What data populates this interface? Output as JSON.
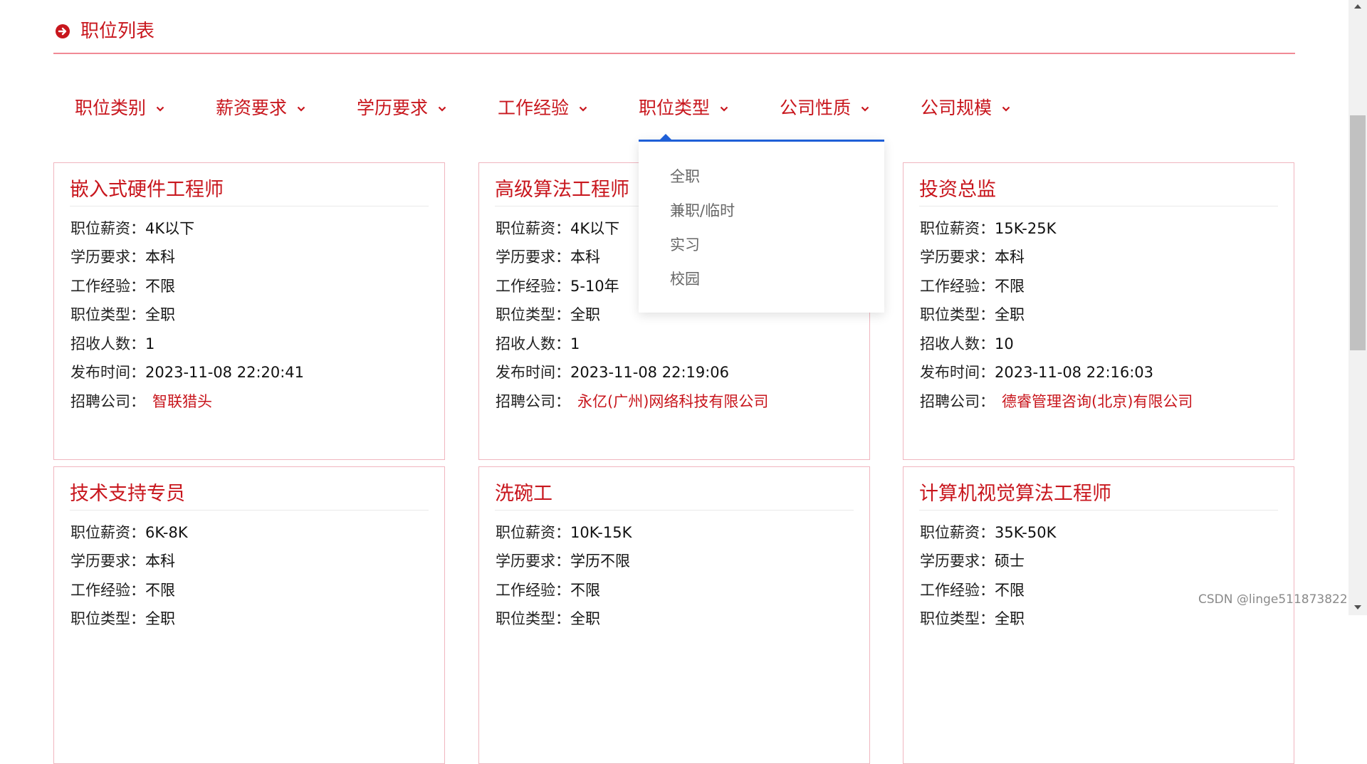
{
  "colors": {
    "accent": "#c8161d",
    "card_border": "#f0b6bf",
    "dropdown_border": "#1e5fd7",
    "scrollbar_thumb": "#c1c1c1"
  },
  "header": {
    "icon": "arrow-right-circle-icon",
    "title": "职位列表"
  },
  "filters": [
    {
      "label": "职位类别",
      "icon": "chevron-down-icon"
    },
    {
      "label": "薪资要求",
      "icon": "chevron-down-icon"
    },
    {
      "label": "学历要求",
      "icon": "chevron-down-icon"
    },
    {
      "label": "工作经验",
      "icon": "chevron-down-icon"
    },
    {
      "label": "职位类型",
      "icon": "chevron-down-icon"
    },
    {
      "label": "公司性质",
      "icon": "chevron-down-icon"
    },
    {
      "label": "公司规模",
      "icon": "chevron-down-icon"
    }
  ],
  "dropdown": {
    "options": [
      "全职",
      "兼职/临时",
      "实习",
      "校园"
    ]
  },
  "field_labels": {
    "salary": "职位薪资：",
    "education": "学历要求：",
    "experience": "工作经验：",
    "job_type": "职位类型：",
    "headcount": "招收人数：",
    "published": "发布时间：",
    "company": "招聘公司："
  },
  "jobs": [
    {
      "title": "嵌入式硬件工程师",
      "salary": "4K以下",
      "education": "本科",
      "experience": "不限",
      "job_type": "全职",
      "headcount": "1",
      "published": "2023-11-08 22:20:41",
      "company": "智联猎头"
    },
    {
      "title": "高级算法工程师",
      "salary": "4K以下",
      "education": "本科",
      "experience": "5-10年",
      "job_type": "全职",
      "headcount": "1",
      "published": "2023-11-08 22:19:06",
      "company": "永亿(广州)网络科技有限公司"
    },
    {
      "title": "投资总监",
      "salary": "15K-25K",
      "education": "本科",
      "experience": "不限",
      "job_type": "全职",
      "headcount": "10",
      "published": "2023-11-08 22:16:03",
      "company": "德睿管理咨询(北京)有限公司"
    },
    {
      "title": "技术支持专员",
      "salary": "6K-8K",
      "education": "本科",
      "experience": "不限",
      "job_type": "全职"
    },
    {
      "title": "洗碗工",
      "salary": "10K-15K",
      "education": "学历不限",
      "experience": "不限",
      "job_type": "全职"
    },
    {
      "title": "计算机视觉算法工程师",
      "salary": "35K-50K",
      "education": "硕士",
      "experience": "不限",
      "job_type": "全职"
    }
  ],
  "watermark": "CSDN @linge511873822"
}
